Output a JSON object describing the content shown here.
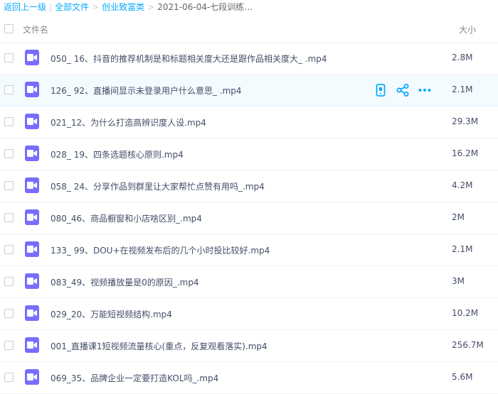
{
  "breadcrumb": {
    "back": "返回上一级",
    "all_files": "全部文件",
    "folder": "创业致富类",
    "current": "2021-06-04-七段训练…"
  },
  "header": {
    "name_label": "文件名",
    "size_label": "大小"
  },
  "colors": {
    "accent": "#09aaff",
    "video_icon": "#7a6dfb",
    "hover_row": "#f4fbff"
  },
  "files": [
    {
      "name": "050_ 16、抖音的推荐机制是和标题相关度大还是跟作品相关度大_ .mp4",
      "size": "2.8M",
      "icon": "video-icon"
    },
    {
      "name": "126_ 92、直播间显示未登录用户什么意思_ .mp4",
      "size": "2.1M",
      "icon": "video-icon",
      "hovered": true,
      "actions": [
        "phone-icon",
        "share-icon",
        "more-icon"
      ]
    },
    {
      "name": "021_12、为什么打造高辨识度人设.mp4",
      "size": "29.3M",
      "icon": "video-icon"
    },
    {
      "name": "028_ 19、四条选题核心原则.mp4",
      "size": "16.2M",
      "icon": "video-icon"
    },
    {
      "name": "058_ 24、分享作品到群里让大家帮忙点赞有用吗_.mp4",
      "size": "4.2M",
      "icon": "video-icon"
    },
    {
      "name": "080_46、商品橱窗和小店啥区别_.mp4",
      "size": "2M",
      "icon": "video-icon"
    },
    {
      "name": "133_ 99、DOU+在视频发布后的几个小时投比较好.mp4",
      "size": "2.1M",
      "icon": "video-icon"
    },
    {
      "name": "083_49、视频播放量是0的原因_.mp4",
      "size": "3M",
      "icon": "video-icon"
    },
    {
      "name": "029_20、万能短视频结构.mp4",
      "size": "10.2M",
      "icon": "video-icon"
    },
    {
      "name": "001_直播课1短视频流量核心(重点，反复观看落实).mp4",
      "size": "256.7M",
      "icon": "video-icon"
    },
    {
      "name": "069_35、品牌企业一定要打造KOL吗_.mp4",
      "size": "5.6M",
      "icon": "video-icon"
    }
  ]
}
